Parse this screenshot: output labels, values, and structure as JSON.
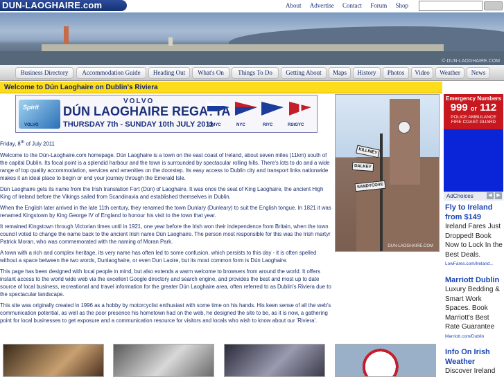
{
  "brand": {
    "logo_main": "DUN-LAOGHAIRE",
    "logo_dot": ".",
    "logo_tld": "com"
  },
  "top_links": [
    "About",
    "Advertise",
    "Contact",
    "Forum",
    "Shop"
  ],
  "search": {
    "placeholder": ""
  },
  "banner": {
    "watermark": "© DUN-LAOGHAIRE.COM"
  },
  "nav": [
    "Business Directory",
    "Accommodation Guide",
    "Heading Out",
    "What's On",
    "Things To Do",
    "Getting About",
    "Maps",
    "History",
    "Photos",
    "Video",
    "Weather",
    "News"
  ],
  "welcome_title": "Welcome to Dún Laoghaire on Dublin's Riviera",
  "regatta": {
    "brand_top": "VOLVO",
    "spirit": "Spirit",
    "brand_small": "VOLVO",
    "title": "DÚN LAOGHAIRE REGATTA",
    "dates": "THURSDAY 7th - SUNDAY 10th JULY 2011",
    "clubs": [
      "DMYC",
      "NYC",
      "RIYC",
      "RStGYC"
    ]
  },
  "date": {
    "prefix": "Friday, 8",
    "sup": "th",
    "suffix": " of July 2011"
  },
  "paragraphs": [
    "Welcome to the Dún-Laoghaire.com homepage. Dún Laoghaire is a town on the east coast of Ireland, about seven miles (11km) south of the capital Dublin. Its focal point is a splendid harbour and the town is surrounded by spectacular rolling hills. There's lots to do and a wide range of top quality accommodation, services and amenities on the doorstep. Its easy access to Dublin city and transport links nationwide makes it an ideal place to begin or end your journey through the Emerald Isle.",
    "Dún Laoghaire gets its name from the Irish translation Fort (Dún) of Laoghaire. It was once the seat of King Laoghaire, the ancient High King of Ireland before the Vikings sailed from Scandinavia and established themselves in Dublin.",
    "When the English later arrived in the late 11th century, they renamed the town Dunlary (Dunleary) to suit the English tongue. In 1821 it was renamed Kingstown by King George IV of England to honour his visit to the town that year.",
    "It remained Kingstown through Victorian times until in 1921, one year before the Irish won their independence from Britain, when the town council voted to change the name back to the ancient Irish name Dún Laoghaire. The person most responsible for this was the Irish martyr Patrick Moran, who was commemorated with the naming of Moran Park.",
    "A town with a rich and complex heritage, its very name has often led to some confusion, which persists to this day - it is often spelled without a space between the two words, Dunlaoghaire, or even Dun Laoire, but its most common form is Dún Laoghaire.",
    "This page has been designed with local people in mind, but also extends a warm welcome to browsers from around the world. It offers instant access to the world wide web via the excellent Google directory and search engine, and provides the best and most up to date source of local business, recreational and travel information for the greater Dún Laoghaire area, often referred to as Dublin's Riviera due to the spectacular landscape.",
    "This site was originally created in 1996 as a hobby by motorcyclist enthusiast with some time on his hands. His keen sense of all the web's communication potential, as well as the poor presence his hometown had on the web, he designed the site to be, as it is now, a gathering point for local businesses to get exposure and a communication resource for visitors and locals who wish to know about our 'Riviera'."
  ],
  "photo": {
    "signs": [
      "KILLINEY",
      "DALKEY",
      "SANDYCOVE"
    ],
    "watermark": "DUN-LAOGHAIRE.COM"
  },
  "emergency": {
    "title": "Emergency Numbers",
    "num1": "999",
    "or": "or",
    "num2": "112",
    "line1": "POLICE AMBULANCE",
    "line2": "FIRE COAST GUARD"
  },
  "adchoices": {
    "label": "AdChoices",
    "prev": "◀",
    "next": "▶"
  },
  "ads": [
    {
      "title": "Fly to Ireland from $149",
      "body": "Ireland Fares Just Dropped! Book Now to Lock In the Best Deals.",
      "url": "LowFares.com/Ireland..."
    },
    {
      "title": "Marriott Dublin",
      "body": "Luxury Bedding & Smart Work Spaces. Book Marriott's Best Rate Guarantee",
      "url": "Marriott.com/Dublin"
    },
    {
      "title": "Info On Irish Weather",
      "body": "Discover Ireland"
    }
  ],
  "colors": {
    "brand_blue": "#1a2f7a",
    "welcome_yellow": "#fddc1c",
    "emergency_red": "#c6181e",
    "ad_blue": "#0a24d8"
  }
}
